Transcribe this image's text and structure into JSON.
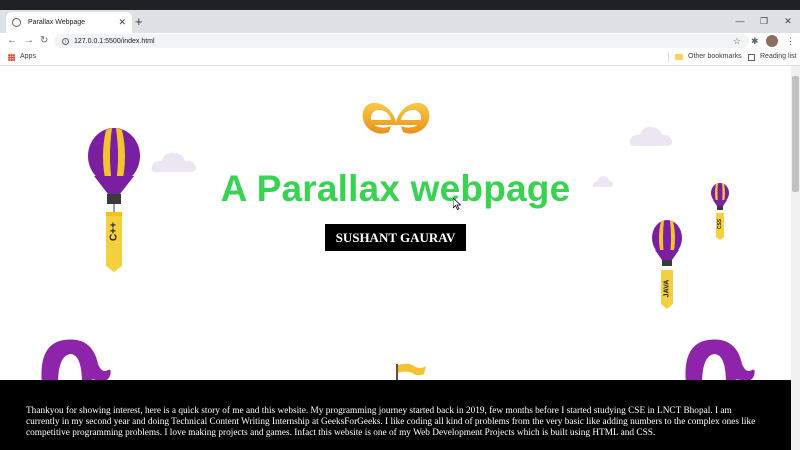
{
  "browser": {
    "tab_title": "Parallax Webpage",
    "tab_close": "✕",
    "new_tab": "+",
    "window_controls": {
      "minimize": "—",
      "restore": "❐",
      "close": "✕"
    },
    "url": "127.0.0.1:5500/index.html",
    "bookmarks": {
      "apps": "Apps",
      "other": "Other bookmarks",
      "reading": "Reading list"
    }
  },
  "page": {
    "title": "A Parallax webpage",
    "author": "SUSHANT GAURAV",
    "balloon_labels": [
      "C++",
      "CSS",
      "JAVA"
    ],
    "story": "Thankyou for showing interest, here is a quick story of me and this website. My programming journey started back in 2019, few months before I started studying CSE in LNCT Bhopal. I am currently in my second year and doing Technical Content Writing Internship at GeeksForGeeks. I like coding all kind of problems from the very basic like adding numbers to the complex ones like competitive programming problems. I love making projects and games. Infact this website is one of my Web Development Projects which is built using HTML and CSS."
  },
  "colors": {
    "title_green": "#39d353",
    "balloon_purple": "#7b1fa2",
    "balloon_yellow": "#f4c430",
    "logo_gold": "#f0a020"
  }
}
